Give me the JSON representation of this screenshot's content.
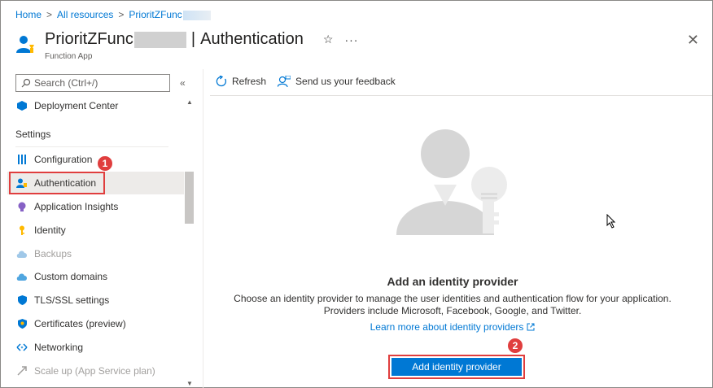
{
  "breadcrumb": {
    "home": "Home",
    "sep": ">",
    "all_resources": "All resources",
    "resource": "PrioritZFunc"
  },
  "header": {
    "name": "PrioritZFunc",
    "bar": "|",
    "page": "Authentication",
    "subtitle": "Function App",
    "star": "☆",
    "more": "···",
    "close": "✕"
  },
  "sidebar": {
    "search_placeholder": "Search (Ctrl+/)",
    "collapse": "«",
    "section": "Settings",
    "items": [
      {
        "label": "Deployment Center",
        "icon": "deployment-center-icon",
        "color": "#0078d4",
        "disabled": false
      },
      {
        "label": "Configuration",
        "icon": "configuration-icon",
        "color": "#0078d4",
        "disabled": false
      },
      {
        "label": "Authentication",
        "icon": "authentication-icon",
        "color": "#0078d4",
        "disabled": false,
        "active": true
      },
      {
        "label": "Application Insights",
        "icon": "application-insights-icon",
        "color": "#8661c5",
        "disabled": false
      },
      {
        "label": "Identity",
        "icon": "identity-icon",
        "color": "#ffb900",
        "disabled": false
      },
      {
        "label": "Backups",
        "icon": "backups-icon",
        "color": "#a0c8e8",
        "disabled": true
      },
      {
        "label": "Custom domains",
        "icon": "custom-domains-icon",
        "color": "#50a6e0",
        "disabled": false
      },
      {
        "label": "TLS/SSL settings",
        "icon": "tls-ssl-icon",
        "color": "#0078d4",
        "disabled": false
      },
      {
        "label": "Certificates (preview)",
        "icon": "certificates-icon",
        "color": "#0078d4",
        "disabled": false
      },
      {
        "label": "Networking",
        "icon": "networking-icon",
        "color": "#0078d4",
        "disabled": false
      },
      {
        "label": "Scale up (App Service plan)",
        "icon": "scale-up-icon",
        "color": "#a19f9d",
        "disabled": true
      }
    ]
  },
  "toolbar": {
    "refresh": "Refresh",
    "feedback": "Send us your feedback"
  },
  "empty_state": {
    "title": "Add an identity provider",
    "desc_line1": "Choose an identity provider to manage the user identities and authentication flow for your application.",
    "desc_line2": "Providers include Microsoft, Facebook, Google, and Twitter.",
    "learn_more": "Learn more about identity providers",
    "button": "Add identity provider"
  },
  "callouts": {
    "one": "1",
    "two": "2"
  },
  "colors": {
    "accent": "#0078d4",
    "callout": "#e03e3e"
  }
}
